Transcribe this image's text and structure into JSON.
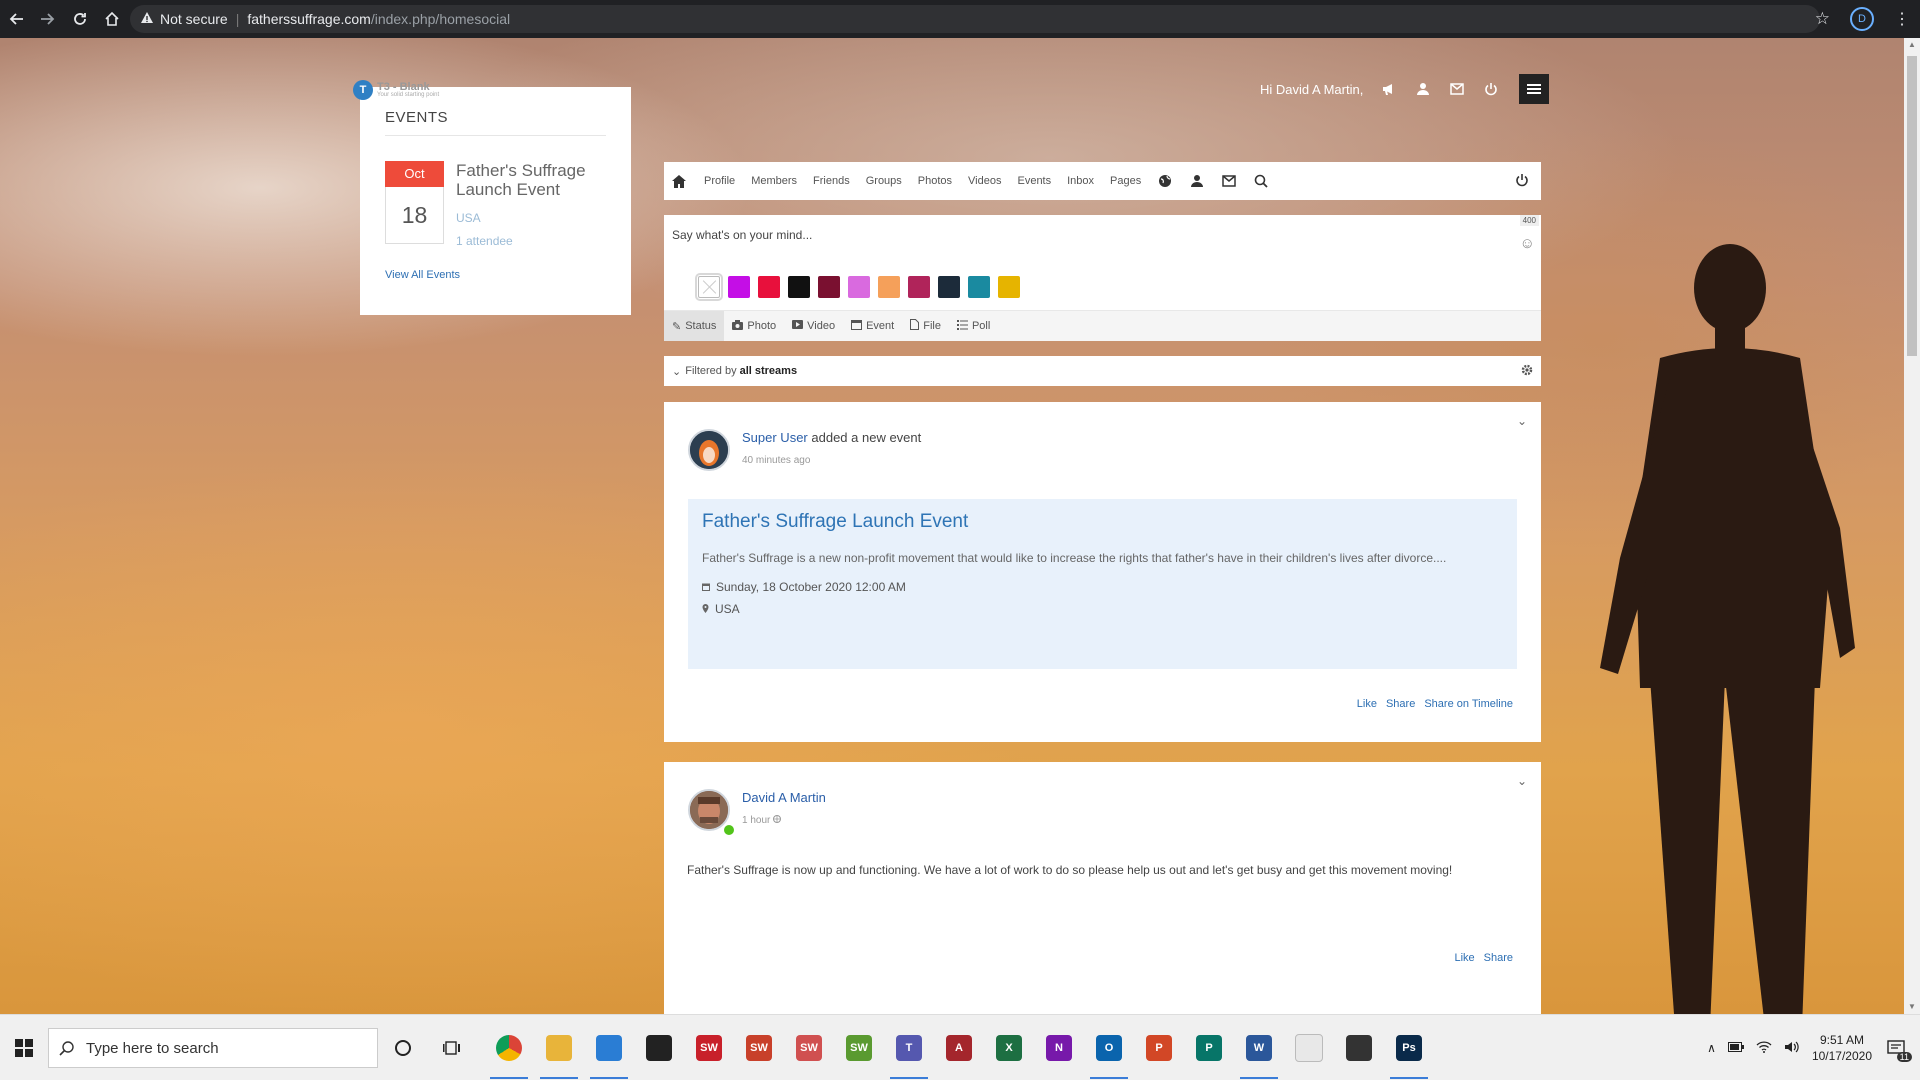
{
  "browser": {
    "security_label": "Not secure",
    "url_host": "fatherssuffrage.com",
    "url_path": "/index.php/homesocial",
    "profile_initial": "D"
  },
  "site": {
    "logo_text": "T3 - Blank",
    "logo_sub": "Your solid starting point"
  },
  "events_widget": {
    "title": "EVENTS",
    "event": {
      "month": "Oct",
      "day": "18",
      "name": "Father's Suffrage Launch Event",
      "location": "USA",
      "attendees": "1 attendee"
    },
    "view_all": "View All Events"
  },
  "user_bar": {
    "greeting": "Hi David A Martin,"
  },
  "nav": {
    "items": [
      "Profile",
      "Members",
      "Friends",
      "Groups",
      "Photos",
      "Videos",
      "Events",
      "Inbox",
      "Pages"
    ]
  },
  "composer": {
    "placeholder": "Say what's on your mind...",
    "char_limit": "400",
    "colors": [
      "#ffffff",
      "#c40ee6",
      "#e8103c",
      "#111111",
      "#7a1030",
      "#d96adf",
      "#f5a05a",
      "#b0245a",
      "#1c2b3a",
      "#1a8aa0",
      "#e6b400"
    ],
    "tabs": [
      "Status",
      "Photo",
      "Video",
      "Event",
      "File",
      "Poll"
    ]
  },
  "filter": {
    "prefix": "Filtered by",
    "value": "all streams"
  },
  "posts": [
    {
      "actor": "Super User",
      "action": "added a new event",
      "time": "40 minutes ago",
      "event_title": "Father's Suffrage Launch Event",
      "event_desc": "Father's Suffrage is a new non-profit movement that would like to increase the rights that father's have in their children's lives after divorce....",
      "event_date": "Sunday, 18 October 2020 12:00 AM",
      "event_location": "USA",
      "actions": [
        "Like",
        "Share",
        "Share on Timeline"
      ]
    },
    {
      "actor": "David A Martin",
      "time": "1 hour",
      "body": "Father's Suffrage is now up and functioning. We have a lot of work to do so please help us out and let's get busy and get this movement moving!",
      "actions": [
        "Like",
        "Share"
      ]
    }
  ],
  "taskbar": {
    "search_placeholder": "Type here to search",
    "time": "9:51 AM",
    "date": "10/17/2020",
    "notification_count": "11",
    "apps": [
      {
        "name": "chrome",
        "color": "#e04a3a",
        "label": ""
      },
      {
        "name": "file-explorer",
        "color": "#e8b43a",
        "label": ""
      },
      {
        "name": "mail",
        "color": "#2a7dd4",
        "label": ""
      },
      {
        "name": "app-black",
        "color": "#222222",
        "label": ""
      },
      {
        "name": "solidworks-2019",
        "color": "#c8202a",
        "label": "SW"
      },
      {
        "name": "solidworks-2018",
        "color": "#c8402a",
        "label": "SW"
      },
      {
        "name": "solidworks-2016",
        "color": "#d05050",
        "label": "SW"
      },
      {
        "name": "solidworks-green",
        "color": "#5a9a30",
        "label": "SW"
      },
      {
        "name": "teams",
        "color": "#5558af",
        "label": "T"
      },
      {
        "name": "access",
        "color": "#a4262c",
        "label": "A"
      },
      {
        "name": "excel",
        "color": "#1d6f42",
        "label": "X"
      },
      {
        "name": "onenote",
        "color": "#7719aa",
        "label": "N"
      },
      {
        "name": "outlook",
        "color": "#0a64ad",
        "label": "O"
      },
      {
        "name": "powerpoint",
        "color": "#d24726",
        "label": "P"
      },
      {
        "name": "publisher",
        "color": "#077568",
        "label": "P"
      },
      {
        "name": "word",
        "color": "#2b579a",
        "label": "W"
      },
      {
        "name": "acrobat",
        "color": "#e8e8e8",
        "label": ""
      },
      {
        "name": "snipping-tool",
        "color": "#333333",
        "label": ""
      },
      {
        "name": "photoshop",
        "color": "#0a2a4a",
        "label": "Ps"
      }
    ]
  }
}
